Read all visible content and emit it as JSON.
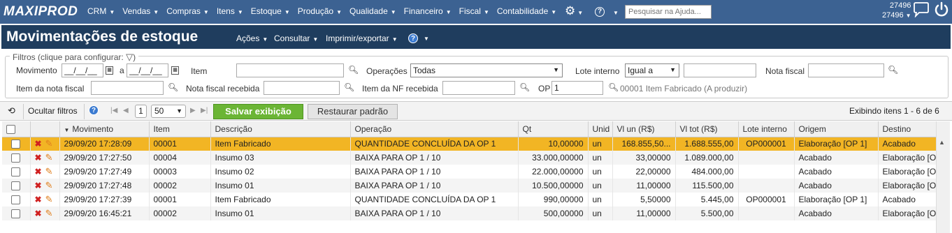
{
  "app": {
    "logo": "MAXIPROD",
    "menu": [
      "CRM",
      "Vendas",
      "Compras",
      "Itens",
      "Estoque",
      "Produção",
      "Qualidade",
      "Financeiro",
      "Fiscal",
      "Contabilidade"
    ],
    "help_search_placeholder": "Pesquisar na Ajuda...",
    "user_id_1": "27496",
    "user_id_2": "27496"
  },
  "page": {
    "title": "Movimentações de estoque",
    "menu": {
      "acoes": "Ações",
      "consultar": "Consultar",
      "imprimir": "Imprimir/exportar"
    }
  },
  "filters": {
    "legend": "Filtros (clique para configurar:",
    "movimento_label": "Movimento",
    "date_from": "__/__/__",
    "date_to": "__/__/__",
    "a_label": "a",
    "item_label": "Item",
    "item_value": "",
    "operacoes_label": "Operações",
    "operacoes_value": "Todas",
    "lote_label": "Lote interno",
    "lote_op": "Igual a",
    "lote_value": "",
    "nota_label": "Nota fiscal",
    "nota_value": "",
    "item_nota_label": "Item da nota fiscal",
    "item_nota_value": "",
    "nota_recebida_label": "Nota fiscal recebida",
    "nota_recebida_value": "",
    "item_nf_recebida_label": "Item da NF recebida",
    "item_nf_recebida_value": "",
    "op_label": "OP",
    "op_value": "1",
    "op_desc": "00001 Item Fabricado (A produzir)"
  },
  "toolbar": {
    "ocultar": "Ocultar filtros",
    "page": "1",
    "page_size": "50",
    "salvar": "Salvar exibição",
    "restaurar": "Restaurar padrão",
    "exibindo": "Exibindo itens 1 - 6 de 6"
  },
  "columns": {
    "movimento": "Movimento",
    "item": "Item",
    "descricao": "Descrição",
    "operacao": "Operação",
    "qt": "Qt",
    "unid": "Unid",
    "vl_un": "Vl un (R$)",
    "vl_tot": "Vl tot (R$)",
    "lote": "Lote interno",
    "origem": "Origem",
    "destino": "Destino"
  },
  "rows": [
    {
      "movimento": "29/09/20 17:28:09",
      "item": "00001",
      "descricao": "Item Fabricado",
      "operacao": "QUANTIDADE CONCLUÍDA DA OP 1",
      "qt": "10,00000",
      "unid": "un",
      "vl_un": "168.855,50...",
      "vl_tot": "1.688.555,00",
      "lote": "OP000001",
      "origem": "Elaboração [OP 1]",
      "destino": "Acabado"
    },
    {
      "movimento": "29/09/20 17:27:50",
      "item": "00004",
      "descricao": "Insumo 03",
      "operacao": "BAIXA PARA OP 1 / 10",
      "qt": "33.000,00000",
      "unid": "un",
      "vl_un": "33,00000",
      "vl_tot": "1.089.000,00",
      "lote": "",
      "origem": "Acabado",
      "destino": "Elaboração [O"
    },
    {
      "movimento": "29/09/20 17:27:49",
      "item": "00003",
      "descricao": "Insumo 02",
      "operacao": "BAIXA PARA OP 1 / 10",
      "qt": "22.000,00000",
      "unid": "un",
      "vl_un": "22,00000",
      "vl_tot": "484.000,00",
      "lote": "",
      "origem": "Acabado",
      "destino": "Elaboração [O"
    },
    {
      "movimento": "29/09/20 17:27:48",
      "item": "00002",
      "descricao": "Insumo 01",
      "operacao": "BAIXA PARA OP 1 / 10",
      "qt": "10.500,00000",
      "unid": "un",
      "vl_un": "11,00000",
      "vl_tot": "115.500,00",
      "lote": "",
      "origem": "Acabado",
      "destino": "Elaboração [O"
    },
    {
      "movimento": "29/09/20 17:27:39",
      "item": "00001",
      "descricao": "Item Fabricado",
      "operacao": "QUANTIDADE CONCLUÍDA DA OP 1",
      "qt": "990,00000",
      "unid": "un",
      "vl_un": "5,50000",
      "vl_tot": "5.445,00",
      "lote": "OP000001",
      "origem": "Elaboração [OP 1]",
      "destino": "Acabado"
    },
    {
      "movimento": "29/09/20 16:45:21",
      "item": "00002",
      "descricao": "Insumo 01",
      "operacao": "BAIXA PARA OP 1 / 10",
      "qt": "500,00000",
      "unid": "un",
      "vl_un": "11,00000",
      "vl_tot": "5.500,00",
      "lote": "",
      "origem": "Acabado",
      "destino": "Elaboração [O"
    }
  ],
  "colors": {
    "topbar": "#3c6292",
    "titlebar": "#1f3d5e",
    "selected_row": "#f2b524",
    "save_button": "#6bb535"
  }
}
